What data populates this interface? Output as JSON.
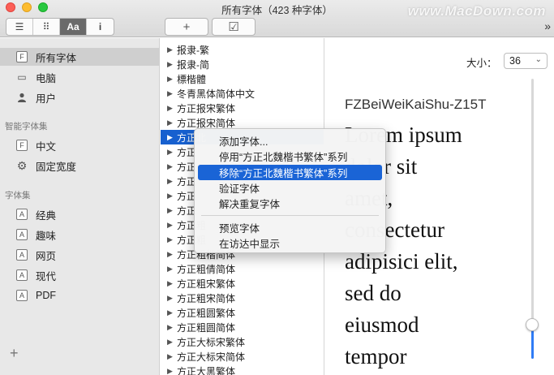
{
  "window": {
    "title": "所有字体（423 种字体）",
    "watermark": "www.MacDown.com"
  },
  "toolbar": {
    "view_buttons": [
      {
        "label": "☰",
        "name": "list-view-icon"
      },
      {
        "label": "⠿",
        "name": "grid-view-icon"
      },
      {
        "label": "Aa",
        "name": "sample-view-button"
      },
      {
        "label": "i",
        "name": "info-view-button"
      }
    ],
    "add_label": "+",
    "check_label": "☑",
    "overflow_label": "»"
  },
  "sidebar": {
    "top_items": [
      {
        "label": "所有字体",
        "icon": "F",
        "selected": true
      },
      {
        "label": "电脑",
        "icon": "▭",
        "selected": false
      },
      {
        "label": "用户",
        "icon": "👤",
        "selected": false
      }
    ],
    "smart_header": "智能字体集",
    "smart_items": [
      {
        "label": "中文",
        "icon": "F"
      },
      {
        "label": "固定宽度",
        "icon": "⚙"
      }
    ],
    "collection_header": "字体集",
    "collections": [
      {
        "label": "经典",
        "icon": "A"
      },
      {
        "label": "趣味",
        "icon": "A"
      },
      {
        "label": "网页",
        "icon": "A"
      },
      {
        "label": "现代",
        "icon": "A"
      },
      {
        "label": "PDF",
        "icon": "A"
      }
    ],
    "add_label": "+"
  },
  "font_list": [
    {
      "label": "报隶-繁",
      "highlight": false
    },
    {
      "label": "报隶-简",
      "highlight": false
    },
    {
      "label": "標楷體",
      "highlight": false
    },
    {
      "label": "冬青黑体简体中文",
      "highlight": false
    },
    {
      "label": "方正报宋繁体",
      "highlight": false
    },
    {
      "label": "方正报宋简体",
      "highlight": false
    },
    {
      "label": "方正北",
      "highlight": true
    },
    {
      "label": "方正",
      "highlight": false
    },
    {
      "label": "方正",
      "highlight": false
    },
    {
      "label": "方正",
      "highlight": false
    },
    {
      "label": "方正",
      "highlight": false
    },
    {
      "label": "方正",
      "highlight": false
    },
    {
      "label": "方正粗",
      "highlight": false
    },
    {
      "label": "方正粗",
      "highlight": false
    },
    {
      "label": "方正粗楷简体",
      "highlight": false
    },
    {
      "label": "方正粗倩简体",
      "highlight": false
    },
    {
      "label": "方正粗宋繁体",
      "highlight": false
    },
    {
      "label": "方正粗宋简体",
      "highlight": false
    },
    {
      "label": "方正粗圆繁体",
      "highlight": false
    },
    {
      "label": "方正粗圆简体",
      "highlight": false
    },
    {
      "label": "方正大标宋繁体",
      "highlight": false
    },
    {
      "label": "方正大标宋简体",
      "highlight": false
    },
    {
      "label": "方正大黑繁体",
      "highlight": false
    }
  ],
  "preview": {
    "size_label": "大小：",
    "size_value": "36",
    "font_name": "FZBeiWeiKaiShu-Z15T",
    "sample_lines": [
      "Lorem ipsum",
      "dolor sit",
      "amet,",
      "consectetur",
      "adipisici elit,",
      "sed do",
      "eiusmod",
      "tempor"
    ]
  },
  "context_menu": {
    "items": [
      {
        "label": "添加字体...",
        "active": false
      },
      {
        "label": "停用“方正北魏楷书繁体”系列",
        "active": false
      },
      {
        "label": "移除“方正北魏楷书繁体”系列",
        "active": true
      },
      {
        "label": "验证字体",
        "active": false
      },
      {
        "label": "解决重复字体",
        "active": false
      },
      {
        "label": "预览字体",
        "active": false
      },
      {
        "label": "在访达中显示",
        "active": false
      }
    ]
  }
}
